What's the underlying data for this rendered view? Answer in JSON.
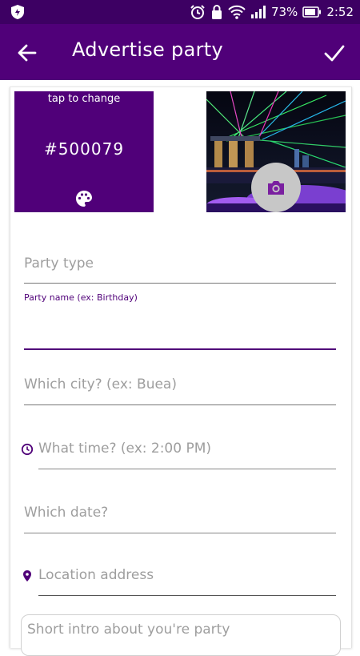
{
  "status": {
    "battery": "73%",
    "time": "2:52"
  },
  "appbar": {
    "title": "Advertise party"
  },
  "color_picker": {
    "hint": "tap to change",
    "hex": "#500079"
  },
  "form": {
    "party_type": {
      "placeholder": "Party type"
    },
    "party_name": {
      "label": "Party name (ex: Birthday)",
      "value": ""
    },
    "city": {
      "placeholder": "Which city? (ex: Buea)"
    },
    "time": {
      "placeholder": "What time? (ex: 2:00 PM)"
    },
    "date": {
      "placeholder": "Which date?"
    },
    "location": {
      "placeholder": "Location address"
    },
    "intro": {
      "placeholder": "Short intro about you're party"
    }
  },
  "colors": {
    "primary": "#500079",
    "statusbar": "#3d0063",
    "hint": "#9e9e9e"
  },
  "icons": [
    "shield-icon",
    "alarm-icon",
    "lock-icon",
    "wifi-icon",
    "signal-icon",
    "battery-icon",
    "back-arrow-icon",
    "check-icon",
    "palette-icon",
    "camera-icon",
    "clock-icon",
    "location-pin-icon"
  ]
}
